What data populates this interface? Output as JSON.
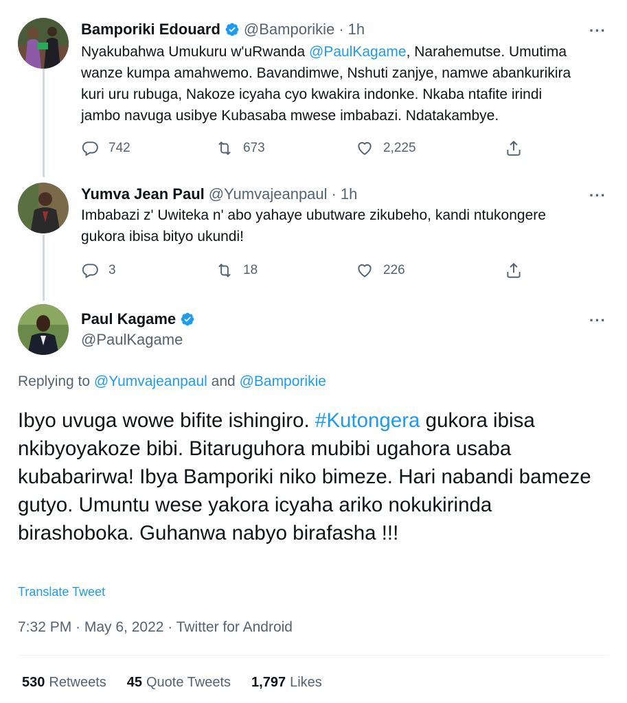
{
  "tweets": [
    {
      "name": "Bamporiki Edouard",
      "handle": "@Bamporikie",
      "dot": "·",
      "time": "1h",
      "verified": true,
      "text_lines": [
        "Nyakubahwa Umukuru w'uRwanda ",
        "@PaulKagame",
        ", Narahemutse. Umutima",
        "wanze kumpa amahwemo. Bavandimwe, Nshuti zanjye, namwe abankurikira",
        "kuri uru rubuga, Nakoze icyaha cyo kwakira indonke. Nkaba ntafite irindi",
        "jambo navuga usibye Kubasaba mwese imbabazi. Ndatakambye."
      ],
      "replies": "742",
      "retweets": "673",
      "likes": "2,225"
    },
    {
      "name": "Yumva Jean Paul",
      "handle": "@Yumvajeanpaul",
      "dot": "·",
      "time": "1h",
      "verified": false,
      "text_lines": [
        "Imbabazi z' Uwiteka n' abo yahaye ubutware zikubeho, kandi ntukongere",
        "gukora ibisa bityo ukundi!"
      ],
      "replies": "3",
      "retweets": "18",
      "likes": "226"
    }
  ],
  "main": {
    "name": "Paul Kagame",
    "handle": "@PaulKagame",
    "replying_prefix": "Replying to ",
    "replying_user1": "@Yumvajeanpaul",
    "replying_and": " and ",
    "replying_user2": "@Bamporikie",
    "text_before_tag": "Ibyo uvuga wowe bifite ishingiro. ",
    "hashtag": "#Kutongera",
    "text_after_tag": " gukora ibisa nkibyoyakoze bibi. Bitaruguhora mubibi ugahora usaba kubabarirwa! Ibya Bamporiki niko bimeze. Hari nabandi bameze gutyo. Umuntu wese yakora icyaha ariko nokukirinda birashoboka. Guhanwa nabyo birafasha !!!",
    "translate": "Translate Tweet",
    "timestamp": "7:32 PM · May 6, 2022 · Twitter for Android",
    "retweets_count": "530",
    "retweets_label": "Retweets",
    "quotes_count": "45",
    "quotes_label": "Quote Tweets",
    "likes_count": "1,797",
    "likes_label": "Likes"
  },
  "more_icon": "···",
  "colors": {
    "accent": "#1d9bf0",
    "secondary": "#536471",
    "text": "#0f1419"
  }
}
